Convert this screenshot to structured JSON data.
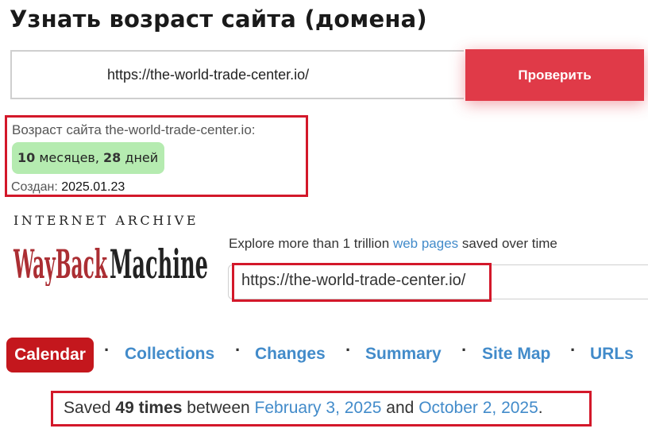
{
  "header": {
    "title": "Узнать возраст сайта (домена)"
  },
  "checker": {
    "input_value": "https://the-world-trade-center.io/",
    "button_label": "Проверить"
  },
  "result": {
    "age_label": "Возраст сайта the-world-trade-center.io:",
    "months_num": "10",
    "months_word": " месяцев, ",
    "days_num": "28",
    "days_word": " дней",
    "created_label": "Создан: ",
    "created_date": "2025.01.23"
  },
  "wayback": {
    "ia_text": "INTERNET ARCHIVE",
    "logo_text": "WayBackMachine",
    "explore_prefix": "Explore more than 1 trillion ",
    "explore_link": "web pages",
    "explore_suffix": " saved over time",
    "search_value": "https://the-world-trade-center.io/",
    "nav": {
      "calendar": "Calendar",
      "collections": "Collections",
      "changes": "Changes",
      "summary": "Summary",
      "site_map": "Site Map",
      "urls": "URLs",
      "separator": "·"
    },
    "saved": {
      "prefix": "Saved ",
      "count": "49 times",
      "between": " between ",
      "start": "February 3, 2025",
      "and": " and ",
      "end": "October 2, 2025",
      "period": "."
    }
  },
  "colors": {
    "accent_red": "#e03a48",
    "highlight_red": "#d3182a",
    "badge_green": "#b5ebb0",
    "link_blue": "#428bca",
    "calendar_red": "#c4171d"
  }
}
